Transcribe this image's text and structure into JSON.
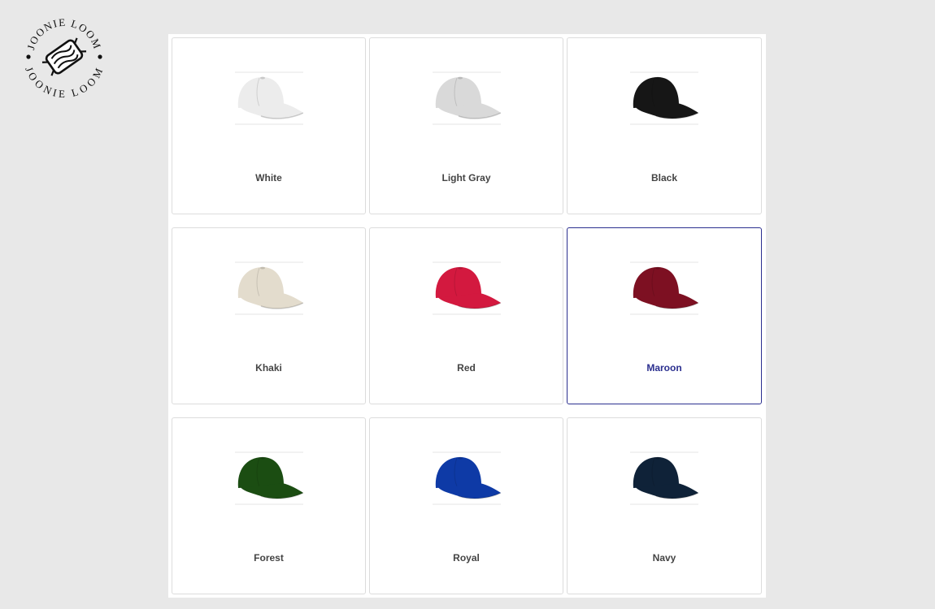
{
  "brand": {
    "name": "JOONIE LOOM",
    "top_text": "JOONIE LOOM",
    "bottom_text": "JOONIE LOOM"
  },
  "selected_color": "Maroon",
  "swatches": [
    {
      "label": "White",
      "color": "#ececec",
      "icon": "white-cap-icon"
    },
    {
      "label": "Light Gray",
      "color": "#d9d9d9",
      "icon": "light-gray-cap-icon"
    },
    {
      "label": "Black",
      "color": "#161616",
      "icon": "black-cap-icon"
    },
    {
      "label": "Khaki",
      "color": "#e3dccd",
      "icon": "khaki-cap-icon"
    },
    {
      "label": "Red",
      "color": "#d3193f",
      "icon": "red-cap-icon"
    },
    {
      "label": "Maroon",
      "color": "#7d1022",
      "icon": "maroon-cap-icon"
    },
    {
      "label": "Forest",
      "color": "#1b4d12",
      "icon": "forest-cap-icon"
    },
    {
      "label": "Royal",
      "color": "#0e3aa6",
      "icon": "royal-cap-icon"
    },
    {
      "label": "Navy",
      "color": "#0f2238",
      "icon": "navy-cap-icon"
    }
  ],
  "colors": {
    "selected_border": "#2b2f8f",
    "label_text": "#444444",
    "page_background": "#e8e8e8"
  }
}
